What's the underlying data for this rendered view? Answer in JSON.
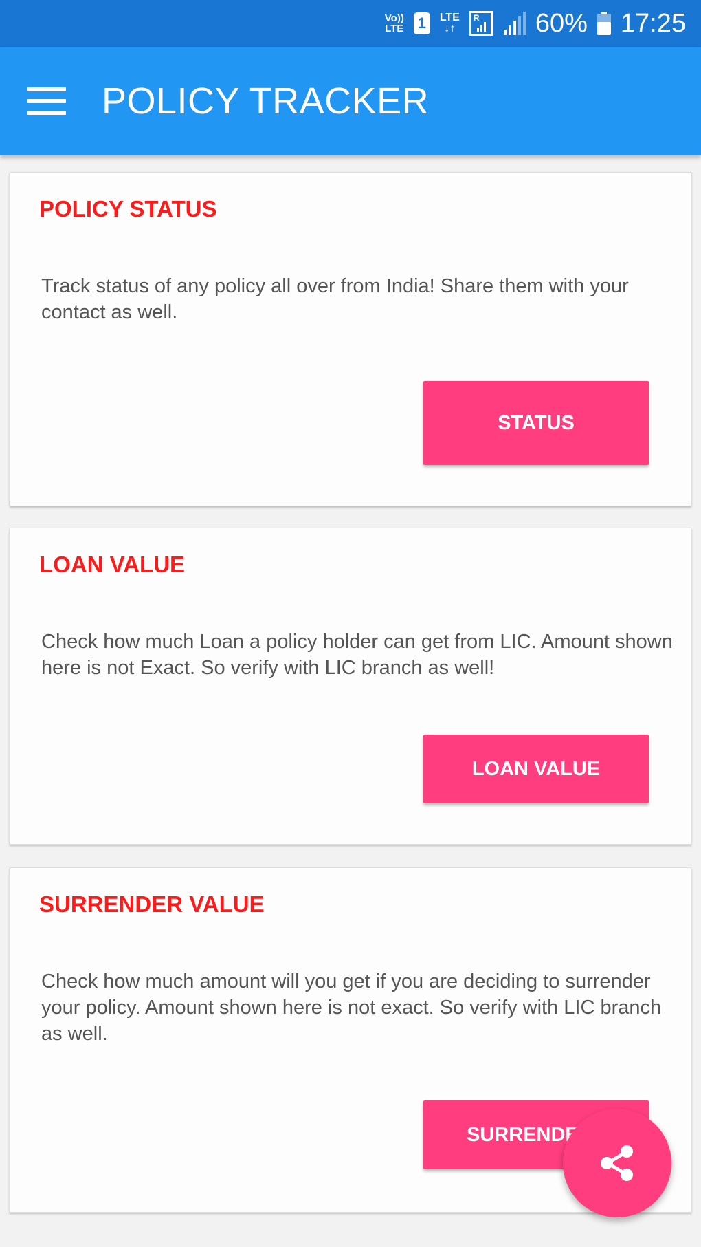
{
  "status_bar": {
    "volte_line1": "Vo))",
    "volte_line2": "LTE",
    "sim_slot": "1",
    "network_type": "LTE",
    "data_arrows": "↓↑",
    "roaming_indicator": "R",
    "battery_percent": "60%",
    "time": "17:25"
  },
  "app_bar": {
    "title": "POLICY TRACKER"
  },
  "cards": [
    {
      "title": "POLICY STATUS",
      "description": "Track status of any policy all over from India! Share them with your contact as well.",
      "button_label": "STATUS"
    },
    {
      "title": "LOAN VALUE",
      "description": "Check how much Loan a policy holder can get from LIC. Amount shown here is not Exact. So verify with LIC branch as well!",
      "button_label": "LOAN VALUE"
    },
    {
      "title": "SURRENDER VALUE",
      "description": "Check how much amount will you get if you are deciding to surrender your policy. Amount shown here is not exact. So verify with LIC branch as well.",
      "button_label": "SURRENDER VALUE"
    }
  ],
  "colors": {
    "status_bar": "#1976d2",
    "app_bar": "#2196f3",
    "card_title": "#ff1a1a",
    "accent": "#ff3d7f",
    "background": "#f2f2f2"
  },
  "icons": {
    "menu": "hamburger-menu-icon",
    "fab": "share-icon"
  }
}
